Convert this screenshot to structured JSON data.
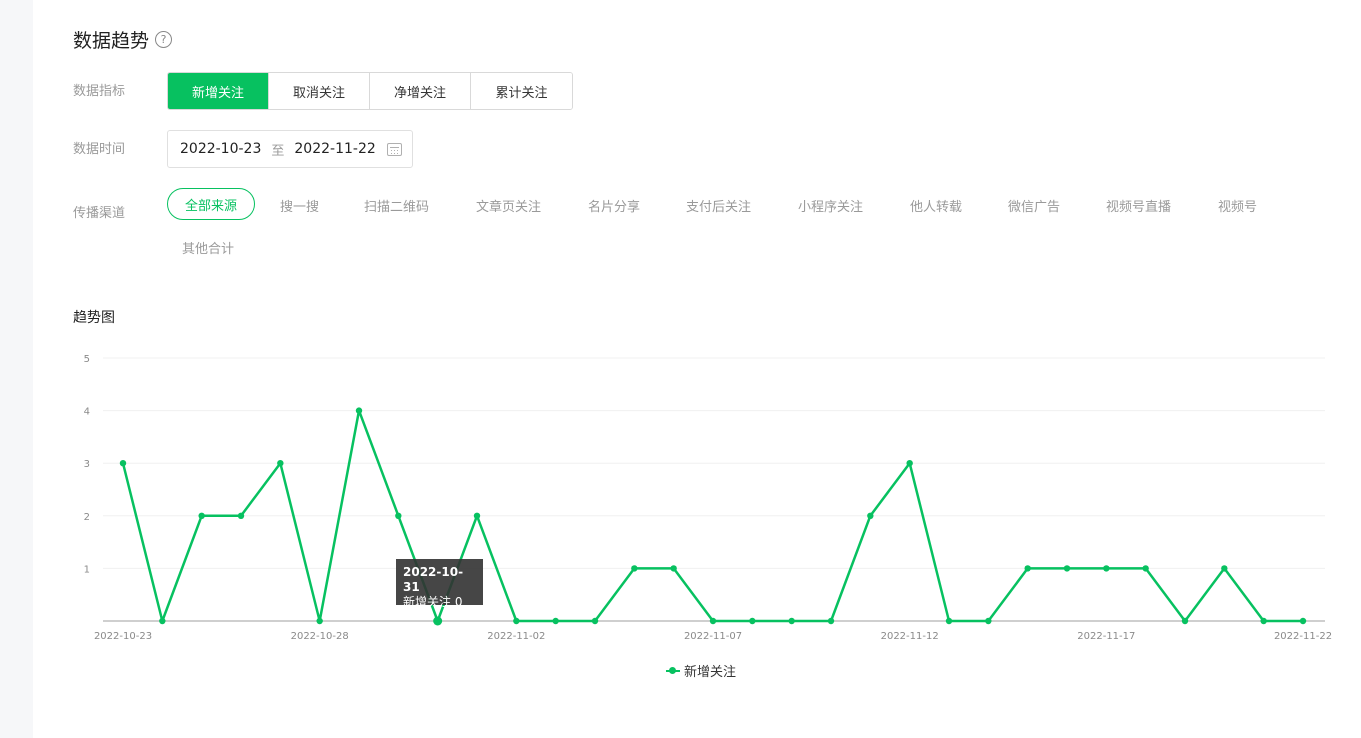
{
  "section": {
    "title": "数据趋势",
    "help_icon": "?"
  },
  "metric": {
    "label": "数据指标",
    "options": [
      "新增关注",
      "取消关注",
      "净增关注",
      "累计关注"
    ],
    "selected": "新增关注"
  },
  "date": {
    "label": "数据时间",
    "start": "2022-10-23",
    "separator": "至",
    "end": "2022-11-22",
    "icon": "calendar-icon"
  },
  "channel": {
    "label": "传播渠道",
    "options": [
      "全部来源",
      "搜一搜",
      "扫描二维码",
      "文章页关注",
      "名片分享",
      "支付后关注",
      "小程序关注",
      "他人转载",
      "微信广告",
      "视频号直播",
      "视频号",
      "其他合计"
    ],
    "selected": "全部来源"
  },
  "chart_title": "趋势图",
  "tooltip": {
    "date": "2022-10-31",
    "text": "新增关注 0"
  },
  "colors": {
    "accent": "#07c160",
    "muted": "#9a9a9a"
  },
  "chart_data": {
    "type": "line",
    "x": [
      "2022-10-23",
      "2022-10-24",
      "2022-10-25",
      "2022-10-26",
      "2022-10-27",
      "2022-10-28",
      "2022-10-29",
      "2022-10-30",
      "2022-10-31",
      "2022-11-01",
      "2022-11-02",
      "2022-11-03",
      "2022-11-04",
      "2022-11-05",
      "2022-11-06",
      "2022-11-07",
      "2022-11-08",
      "2022-11-09",
      "2022-11-10",
      "2022-11-11",
      "2022-11-12",
      "2022-11-13",
      "2022-11-14",
      "2022-11-15",
      "2022-11-16",
      "2022-11-17",
      "2022-11-18",
      "2022-11-19",
      "2022-11-20",
      "2022-11-21",
      "2022-11-22"
    ],
    "series": [
      {
        "name": "新增关注",
        "values": [
          3,
          0,
          2,
          2,
          3,
          0,
          4,
          2,
          0,
          2,
          0,
          0,
          0,
          1,
          1,
          0,
          0,
          0,
          0,
          2,
          3,
          0,
          0,
          1,
          1,
          1,
          1,
          0,
          1,
          0,
          0
        ]
      }
    ],
    "x_tick_labels": [
      "2022-10-23",
      "2022-10-28",
      "2022-11-02",
      "2022-11-07",
      "2022-11-12",
      "2022-11-17",
      "2022-11-22"
    ],
    "y_ticks": [
      "1",
      "2",
      "3",
      "4",
      "5"
    ],
    "ylim": [
      0,
      5
    ],
    "grid": true,
    "legend": "bottom-center"
  }
}
